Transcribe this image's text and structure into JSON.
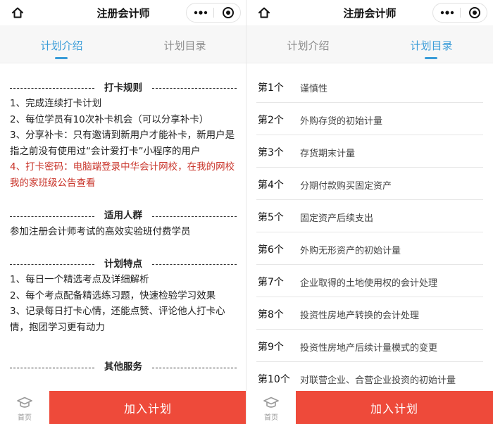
{
  "app": {
    "title": "注册会计师"
  },
  "tabs": {
    "intro": "计划介绍",
    "catalog": "计划目录"
  },
  "intro": {
    "rules": {
      "heading": "打卡规则",
      "lines": [
        "1、完成连续打卡计划",
        "2、每位学员有10次补卡机会（可以分享补卡）",
        "3、分享补卡：只有邀请到新用户才能补卡，新用户是指之前没有使用过“会计爱打卡”小程序的用户",
        "4、打卡密码：电脑端登录中华会计网校，在我的网校我的家班级公告查看"
      ]
    },
    "audience": {
      "heading": "适用人群",
      "lines": [
        "参加注册会计师考试的高效实验班付费学员"
      ]
    },
    "features": {
      "heading": "计划特点",
      "lines": [
        "1、每日一个精选考点及详细解析",
        "2、每个考点配备精选练习题，快速检验学习效果",
        "3、记录每日打卡心情，还能点赞、评论他人打卡心情，抱团学习更有动力"
      ]
    },
    "services": {
      "heading": "其他服务"
    }
  },
  "catalog": {
    "items": [
      {
        "num": "第1个",
        "name": "谨慎性"
      },
      {
        "num": "第2个",
        "name": "外购存货的初始计量"
      },
      {
        "num": "第3个",
        "name": "存货期末计量"
      },
      {
        "num": "第4个",
        "name": "分期付款购买固定资产"
      },
      {
        "num": "第5个",
        "name": "固定资产后续支出"
      },
      {
        "num": "第6个",
        "name": "外购无形资产的初始计量"
      },
      {
        "num": "第7个",
        "name": "企业取得的土地使用权的会计处理"
      },
      {
        "num": "第8个",
        "name": "投资性房地产转换的会计处理"
      },
      {
        "num": "第9个",
        "name": "投资性房地产后续计量模式的变更"
      },
      {
        "num": "第10个",
        "name": "对联营企业、合营企业投资的初始计量"
      }
    ]
  },
  "bottom": {
    "home_label": "首页",
    "join_label": "加入计划"
  },
  "colors": {
    "accent": "#3a9cd8",
    "highlight": "#c9342a",
    "button": "#ee4a3a"
  },
  "icons": {
    "home": "home-icon",
    "more": "more-dots-icon",
    "close": "target-close-icon",
    "home_tab": "graduation-cap-icon"
  }
}
